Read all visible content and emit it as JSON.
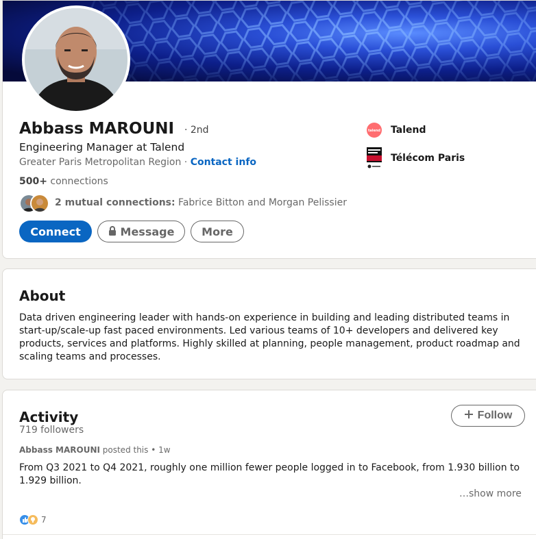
{
  "profile": {
    "name": "Abbass MAROUNI",
    "degree": "· 2nd",
    "headline": "Engineering Manager at Talend",
    "location": "Greater Paris Metropolitan Region",
    "location_sep": " · ",
    "contact_info": "Contact info",
    "connections_count": "500+",
    "connections_label": " connections",
    "mutual_count": "2 mutual connections:",
    "mutual_names": " Fabrice Bitton and Morgan Pelissier",
    "buttons": {
      "connect": "Connect",
      "message": "Message",
      "more": "More"
    },
    "experience": [
      {
        "name": "Talend",
        "icon": "talend-logo",
        "color": "#ff6d70"
      },
      {
        "name": "Télécom Paris",
        "icon": "telecom-paris-logo",
        "color": "#c8102e"
      }
    ]
  },
  "about": {
    "title": "About",
    "text": "Data driven engineering leader with hands-on experience in building and leading distributed teams in start-up/scale-up fast paced environments. Led various teams of 10+ developers and delivered key products, services and platforms. Highly skilled at planning, people management, product roadmap and scaling teams and processes."
  },
  "activity": {
    "title": "Activity",
    "followers": "719 followers",
    "follow_button": "Follow",
    "post": {
      "author": "Abbass MAROUNI",
      "posted": " posted this • 1w",
      "text": "From Q3 2021 to Q4 2021, roughly one million fewer people logged in to Facebook, from 1.930 billion to 1.929 billion.",
      "show_more": "…show more",
      "reaction_count": "7"
    }
  },
  "colors": {
    "primary": "#0a66c2",
    "background": "#f3f2ef"
  }
}
